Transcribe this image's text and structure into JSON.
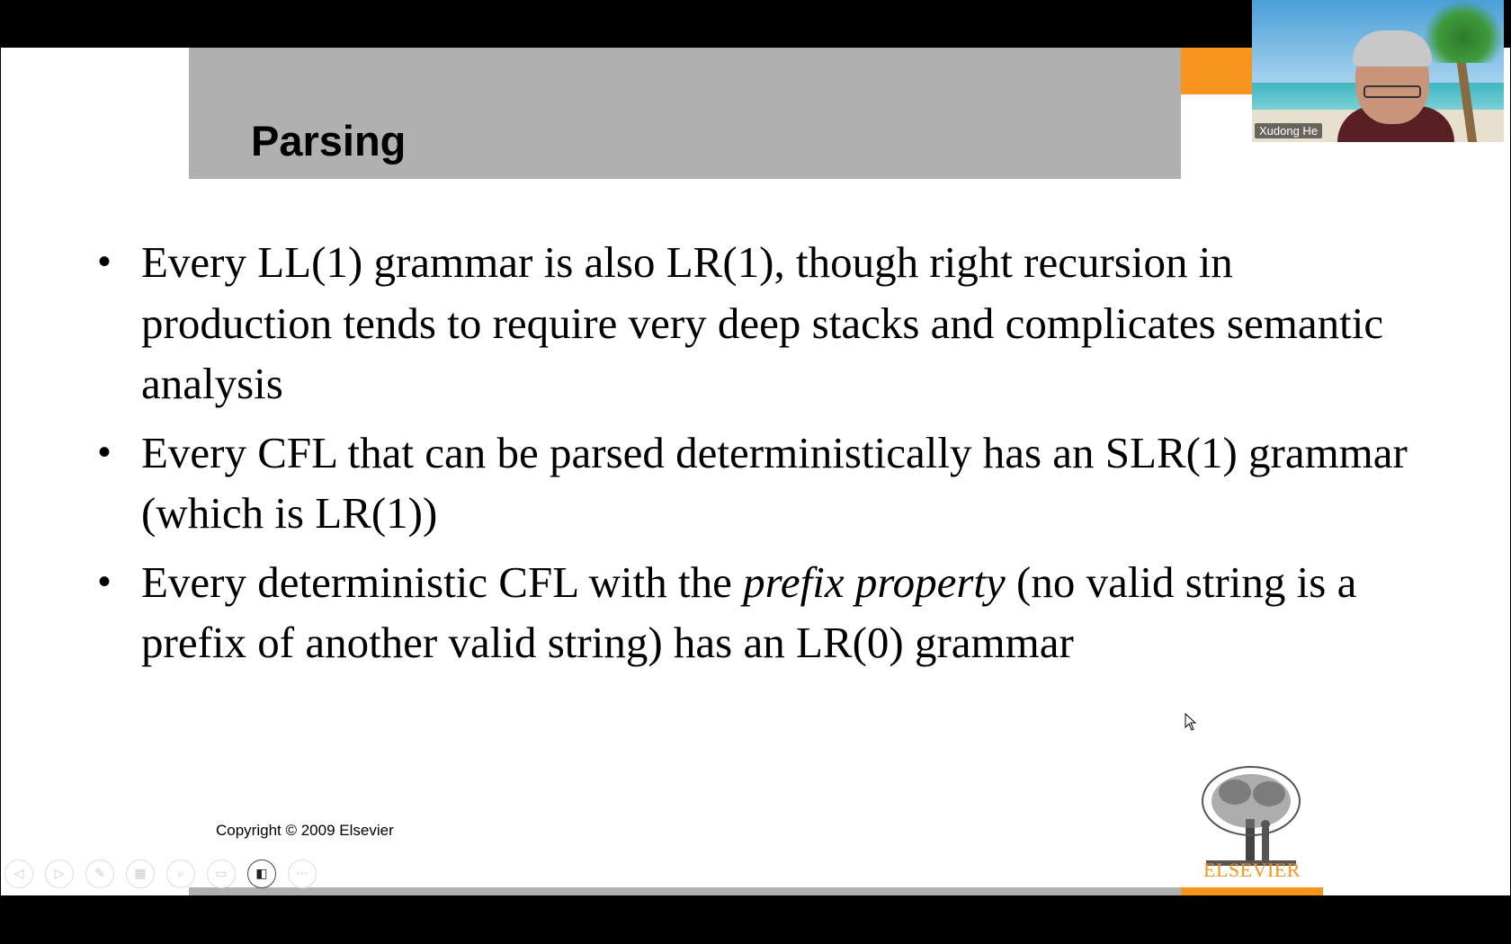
{
  "slide": {
    "title": "Parsing",
    "bullets": [
      {
        "text": "Every LL(1) grammar is also LR(1), though right recursion in production tends to require very deep stacks and complicates semantic analysis"
      },
      {
        "text": "Every CFL that can be parsed deterministically has an SLR(1) grammar (which is LR(1))"
      },
      {
        "text_before": "Every deterministic CFL with the ",
        "text_italic": "prefix property",
        "text_after": " (no valid string is a prefix of another valid string) has an LR(0) grammar"
      }
    ],
    "bullet_symbol": "•",
    "copyright": "Copyright © 2009 Elsevier",
    "logo_text": "ELSEVIER"
  },
  "video": {
    "participant_name": "Xudong He"
  },
  "toolbar": {
    "buttons": [
      {
        "name": "previous-slide-icon",
        "glyph": "◁"
      },
      {
        "name": "next-slide-icon",
        "glyph": "▷"
      },
      {
        "name": "pen-icon",
        "glyph": "✎"
      },
      {
        "name": "see-all-slides-icon",
        "glyph": "▦"
      },
      {
        "name": "zoom-icon",
        "glyph": "⌕"
      },
      {
        "name": "subtitles-icon",
        "glyph": "▭"
      },
      {
        "name": "camera-icon",
        "glyph": "◧"
      },
      {
        "name": "more-options-icon",
        "glyph": "⋯"
      }
    ]
  },
  "colors": {
    "title_band": "#b0b0b0",
    "accent_orange": "#f7941d",
    "background": "#000000"
  }
}
